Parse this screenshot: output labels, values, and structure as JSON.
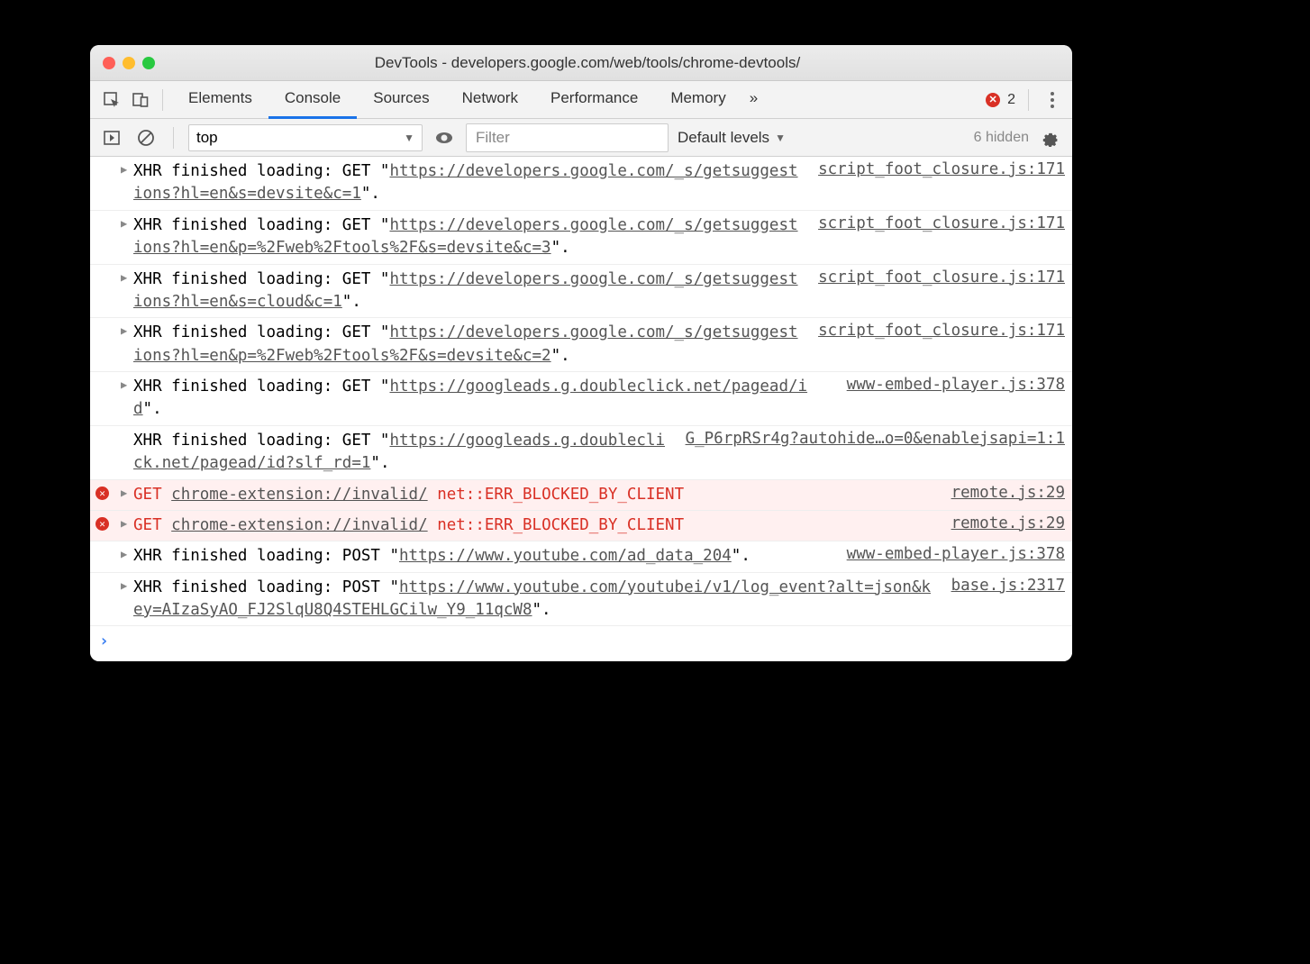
{
  "window": {
    "title": "DevTools - developers.google.com/web/tools/chrome-devtools/"
  },
  "tabs": {
    "items": [
      "Elements",
      "Console",
      "Sources",
      "Network",
      "Performance",
      "Memory"
    ],
    "active": "Console",
    "error_count": "2",
    "overflow": "»"
  },
  "subbar": {
    "context": "top",
    "filter_placeholder": "Filter",
    "levels": "Default levels",
    "hidden": "6 hidden"
  },
  "logs": [
    {
      "type": "log",
      "arrow": true,
      "prefix": "XHR finished loading: GET \"",
      "url": "https://developers.google.com/_s/getsuggestions?hl=en&s=devsite&c=1",
      "suffix": "\".",
      "source": "script_foot_closure.js:171"
    },
    {
      "type": "log",
      "arrow": true,
      "prefix": "XHR finished loading: GET \"",
      "url": "https://developers.google.com/_s/getsuggestions?hl=en&p=%2Fweb%2Ftools%2F&s=devsite&c=3",
      "suffix": "\".",
      "source": "script_foot_closure.js:171"
    },
    {
      "type": "log",
      "arrow": true,
      "prefix": "XHR finished loading: GET \"",
      "url": "https://developers.google.com/_s/getsuggestions?hl=en&s=cloud&c=1",
      "suffix": "\".",
      "source": "script_foot_closure.js:171"
    },
    {
      "type": "log",
      "arrow": true,
      "prefix": "XHR finished loading: GET \"",
      "url": "https://developers.google.com/_s/getsuggestions?hl=en&p=%2Fweb%2Ftools%2F&s=devsite&c=2",
      "suffix": "\".",
      "source": "script_foot_closure.js:171"
    },
    {
      "type": "log",
      "arrow": true,
      "prefix": "XHR finished loading: GET \"",
      "url": "https://googleads.g.doubleclick.net/pagead/id",
      "suffix": "\".",
      "source": "www-embed-player.js:378"
    },
    {
      "type": "log",
      "arrow": false,
      "prefix": "XHR finished loading: GET \"",
      "url": "https://googleads.g.doubleclick.net/pagead/id?slf_rd=1",
      "suffix": "\".",
      "source": "G_P6rpRSr4g?autohide…o=0&enablejsapi=1:1"
    },
    {
      "type": "error",
      "arrow": true,
      "method": "GET",
      "url": "chrome-extension://invalid/",
      "err": "net::ERR_BLOCKED_BY_CLIENT",
      "source": "remote.js:29"
    },
    {
      "type": "error",
      "arrow": true,
      "method": "GET",
      "url": "chrome-extension://invalid/",
      "err": "net::ERR_BLOCKED_BY_CLIENT",
      "source": "remote.js:29"
    },
    {
      "type": "log",
      "arrow": true,
      "prefix": "XHR finished loading: POST \"",
      "url": "https://www.youtube.com/ad_data_204",
      "suffix": "\".",
      "source": "www-embed-player.js:378"
    },
    {
      "type": "log",
      "arrow": true,
      "prefix": "XHR finished loading: POST \"",
      "url": "https://www.youtube.com/youtubei/v1/log_event?alt=json&key=AIzaSyAO_FJ2SlqU8Q4STEHLGCilw_Y9_11qcW8",
      "suffix": "\".",
      "source": "base.js:2317"
    }
  ],
  "prompt": "›"
}
